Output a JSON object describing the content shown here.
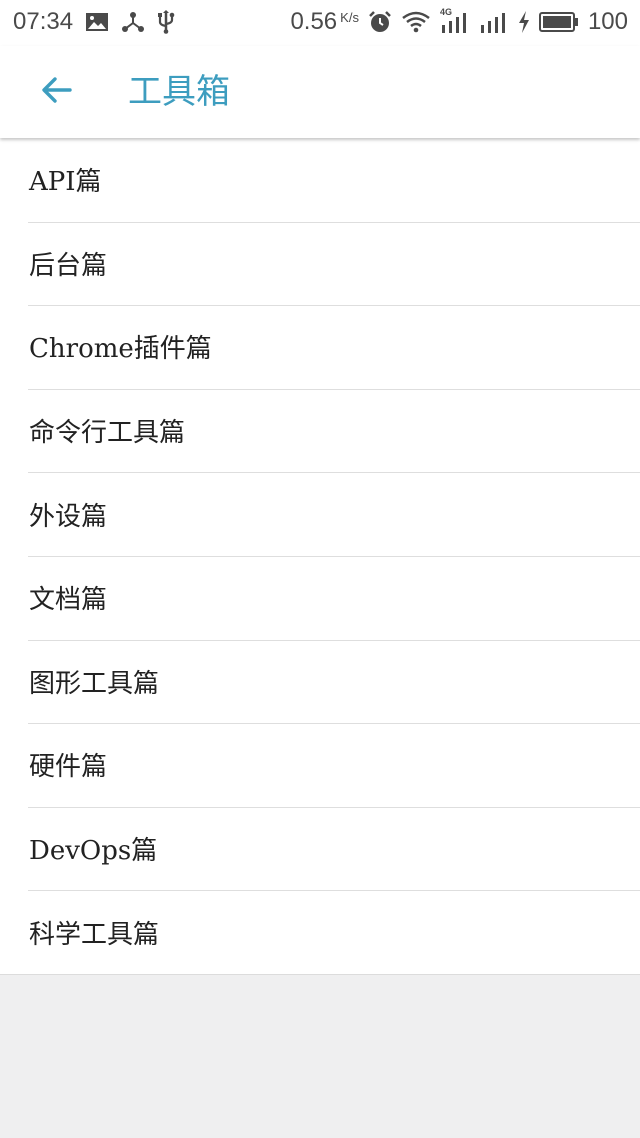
{
  "status_bar": {
    "time": "07:34",
    "left_icons": [
      "image-icon",
      "share-icon",
      "usb-icon"
    ],
    "network_speed": "0.56",
    "network_speed_unit": "K/s",
    "right_icons": [
      "alarm-icon",
      "wifi-icon",
      "signal-4g-icon",
      "signal-icon",
      "charging-icon",
      "battery-icon"
    ],
    "network_type": "4G",
    "battery_percent": "100"
  },
  "app_bar": {
    "back_icon": "arrow-left-icon",
    "title": "工具箱"
  },
  "menu": {
    "items": [
      {
        "label": "API篇"
      },
      {
        "label": "后台篇"
      },
      {
        "label": "Chrome插件篇"
      },
      {
        "label": "命令行工具篇"
      },
      {
        "label": "外设篇"
      },
      {
        "label": "文档篇"
      },
      {
        "label": "图形工具篇"
      },
      {
        "label": "硬件篇"
      },
      {
        "label": "DevOps篇"
      },
      {
        "label": "科学工具篇"
      }
    ]
  },
  "colors": {
    "accent": "#3d9dbf",
    "background": "#efeff0",
    "list_background": "#ffffff",
    "divider": "#dedede",
    "text": "#222222"
  }
}
